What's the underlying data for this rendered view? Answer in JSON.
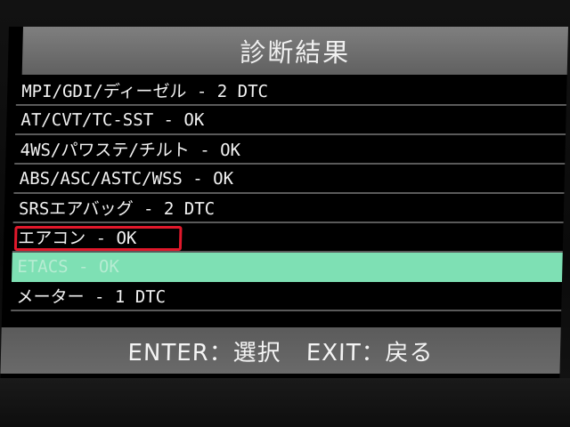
{
  "screen": {
    "title": "診断結果"
  },
  "results": [
    {
      "label": "MPI/GDI/ディーゼル - 2 DTC"
    },
    {
      "label": "AT/CVT/TC-SST - OK"
    },
    {
      "label": "4WS/パワステ/チルト - OK"
    },
    {
      "label": "ABS/ASC/ASTC/WSS - OK"
    },
    {
      "label": "SRSエアバッグ - 2 DTC"
    },
    {
      "label": "エアコン - OK"
    },
    {
      "label": "ETACS - OK"
    },
    {
      "label": "メーター - 1 DTC"
    }
  ],
  "footer": {
    "enter": "ENTER：選択",
    "exit": "EXIT：戻る"
  },
  "colors": {
    "selected_row": "#7ee0b4",
    "annotation_box": "#e0182b"
  }
}
